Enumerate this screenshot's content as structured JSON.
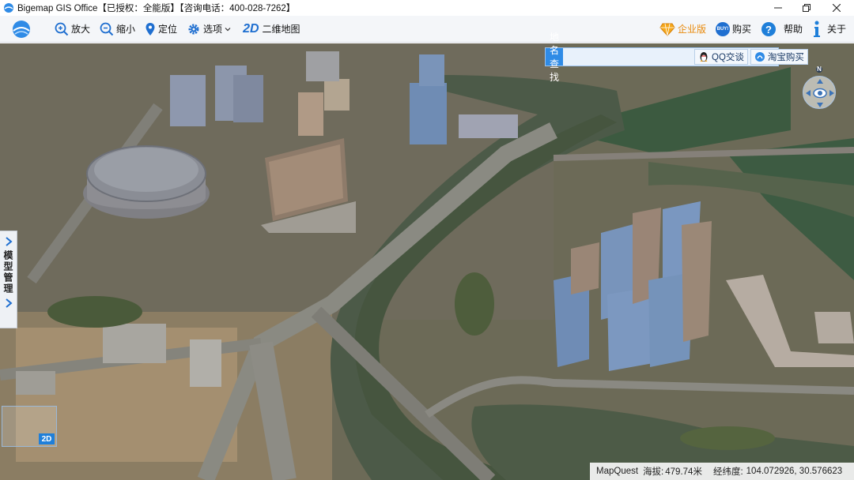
{
  "window": {
    "title": "Bigemap GIS Office【已授权：全能版】【咨询电话：400-028-7262】"
  },
  "toolbar": {
    "zoom_in": "放大",
    "zoom_out": "缩小",
    "locate": "定位",
    "options": "选项",
    "mode_2d": "2D",
    "map_2d": "二维地图",
    "enterprise": "企业版",
    "buy": "购买",
    "buy_badge": "BUY!",
    "help": "帮助",
    "about": "关于"
  },
  "search": {
    "label": "地名查找",
    "value": "",
    "qq_button": "QQ交谈",
    "taobao_button": "淘宝购买"
  },
  "side_panel": {
    "label": "模型管理"
  },
  "navigation": {
    "north": "N"
  },
  "overview": {
    "mode": "2D"
  },
  "status": {
    "provider": "MapQuest",
    "elevation_label": "海拔:",
    "elevation_value": "479.74米",
    "coord_label": "经纬度:",
    "coord_value": "104.072926, 30.576623"
  },
  "colors": {
    "accent": "#2f8be6",
    "toolbar_icon": "#1f6fd0",
    "enterprise": "#e88a0c",
    "help": "#1f7fd9"
  }
}
